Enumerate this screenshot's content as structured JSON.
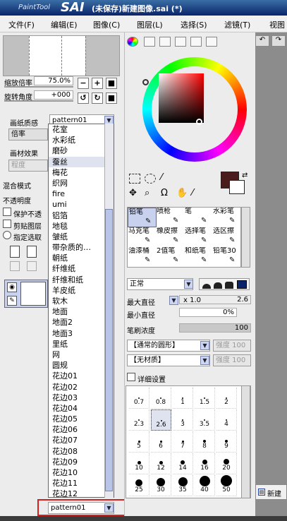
{
  "app": {
    "logo_small": "PaintTool",
    "logo_big": "SAI",
    "title": "(未保存)新建图像.sai (*)"
  },
  "menus": [
    "文件(F)",
    "编辑(E)",
    "图像(C)",
    "图层(L)",
    "选择(S)",
    "滤镜(T)",
    "视图"
  ],
  "navigator": {
    "zoom_label": "缩放倍率",
    "zoom_value": "75.0%",
    "rotate_label": "旋转角度",
    "rotate_value": "+000"
  },
  "paper": {
    "texture_label": "画纸质感",
    "texture_value": "pattern01",
    "rate_label": "倍率",
    "effect_label": "画材效果",
    "degree_label": "程度"
  },
  "layer": {
    "blend_label": "混合模式",
    "opacity_label": "不透明度",
    "protect_label": "保护不透",
    "clip_label": "剪贴图层",
    "select_label": "指定选取",
    "new_label": "新建"
  },
  "texture_list": [
    "花室",
    "水彩纸",
    "磨砂",
    "蚕丝",
    "梅花",
    "织网",
    "fire",
    "umi",
    "铝箔",
    "地毯",
    "皱纸",
    "带杂质的…",
    "朝纸",
    "纤维纸",
    "纤维和纸",
    "羊皮纸",
    "软木",
    "地面",
    "地面2",
    "地面3",
    "里纸",
    "网",
    "圆规",
    "花边01",
    "花边02",
    "花边03",
    "花边04",
    "花边05",
    "花边06",
    "花边07",
    "花边08",
    "花边09",
    "花边10",
    "花边11",
    "花边12",
    "四角尺"
  ],
  "texture_selected": "pattern01",
  "color": {
    "primary": "#4a1c1c",
    "secondary": "#ffffff"
  },
  "tools": [
    {
      "label": "铅笔",
      "icon": "pencil-icon"
    },
    {
      "label": "喷枪",
      "icon": "airbrush-icon"
    },
    {
      "label": "笔",
      "icon": "pen-icon"
    },
    {
      "label": "水彩笔",
      "icon": "watercolor-icon"
    },
    {
      "label": "马克笔",
      "icon": "marker-icon"
    },
    {
      "label": "橡皮擦",
      "icon": "eraser-icon"
    },
    {
      "label": "选择笔",
      "icon": "select-pen-icon"
    },
    {
      "label": "选区擦",
      "icon": "select-eraser-icon"
    },
    {
      "label": "油漆桶",
      "icon": "bucket-icon"
    },
    {
      "label": "2值笔",
      "icon": "binary-pen-icon"
    },
    {
      "label": "和纸笔",
      "icon": "washi-pen-icon"
    },
    {
      "label": "铅笔30",
      "icon": "pencil-icon"
    }
  ],
  "brush": {
    "mode": "正常",
    "max_size_label": "最大直径",
    "max_size_mult": "x 1.0",
    "max_size_value": "2.6",
    "min_size_label": "最小直径",
    "min_size_value": "0%",
    "density_label": "笔刷浓度",
    "density_value": "100",
    "shape": "【通常的圆形】",
    "shape_strength": "强度 100",
    "texture": "【无材质】",
    "texture_strength": "强度 100",
    "detail_label": "详细设置"
  },
  "brush_sizes": [
    "0.7",
    "0.8",
    "1",
    "1.5",
    "2",
    "2.3",
    "2.6",
    "3",
    "3.5",
    "4",
    "5",
    "6",
    "7",
    "8",
    "9",
    "10",
    "12",
    "14",
    "16",
    "20",
    "25",
    "30",
    "35",
    "40",
    "50"
  ],
  "brush_size_selected": "2.6"
}
